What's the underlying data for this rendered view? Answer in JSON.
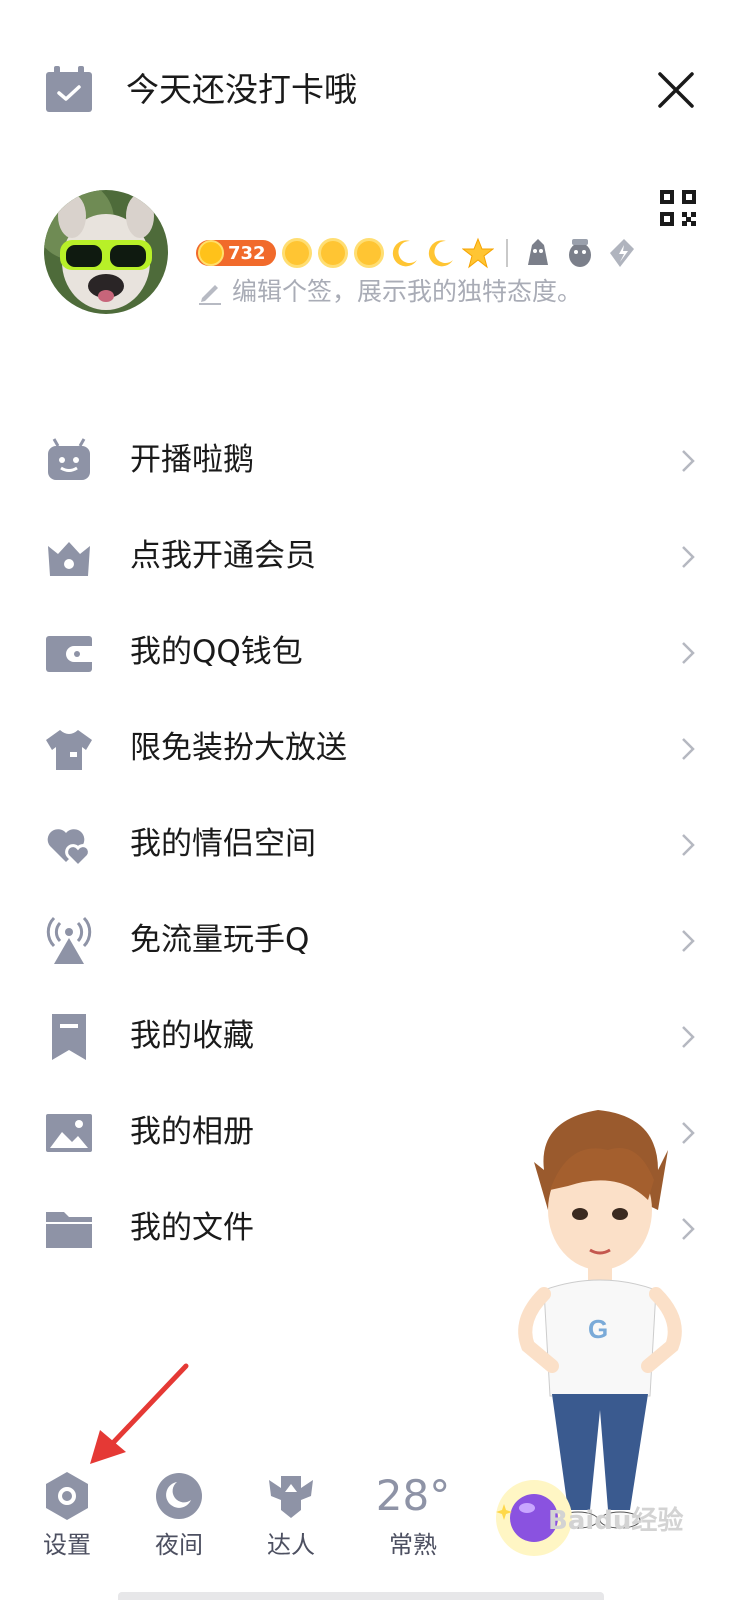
{
  "header": {
    "checkin_text": "今天还没打卡哦"
  },
  "profile": {
    "level_coins": "732",
    "signature_placeholder": "编辑个签，展示我的独特态度。"
  },
  "menu": {
    "items": [
      {
        "label": "开播啦鹅",
        "icon": "tv-robot-icon"
      },
      {
        "label": "点我开通会员",
        "icon": "crown-icon"
      },
      {
        "label": "我的QQ钱包",
        "icon": "wallet-icon"
      },
      {
        "label": "限免装扮大放送",
        "icon": "shirt-icon"
      },
      {
        "label": "我的情侣空间",
        "icon": "hearts-icon"
      },
      {
        "label": "免流量玩手Q",
        "icon": "signal-tower-icon"
      },
      {
        "label": "我的收藏",
        "icon": "bookmark-icon"
      },
      {
        "label": "我的相册",
        "icon": "photo-icon"
      },
      {
        "label": "我的文件",
        "icon": "folder-icon"
      }
    ]
  },
  "bottom_bar": {
    "settings": "设置",
    "night": "夜间",
    "talent": "达人",
    "weather_temp": "28°",
    "weather_city": "常熟"
  },
  "watermark": "Baidu经验",
  "colors": {
    "icon_gray": "#8e93a6",
    "text_primary": "#1a1a1a",
    "text_hint": "#a9acb6",
    "arrow_red": "#e53935"
  }
}
